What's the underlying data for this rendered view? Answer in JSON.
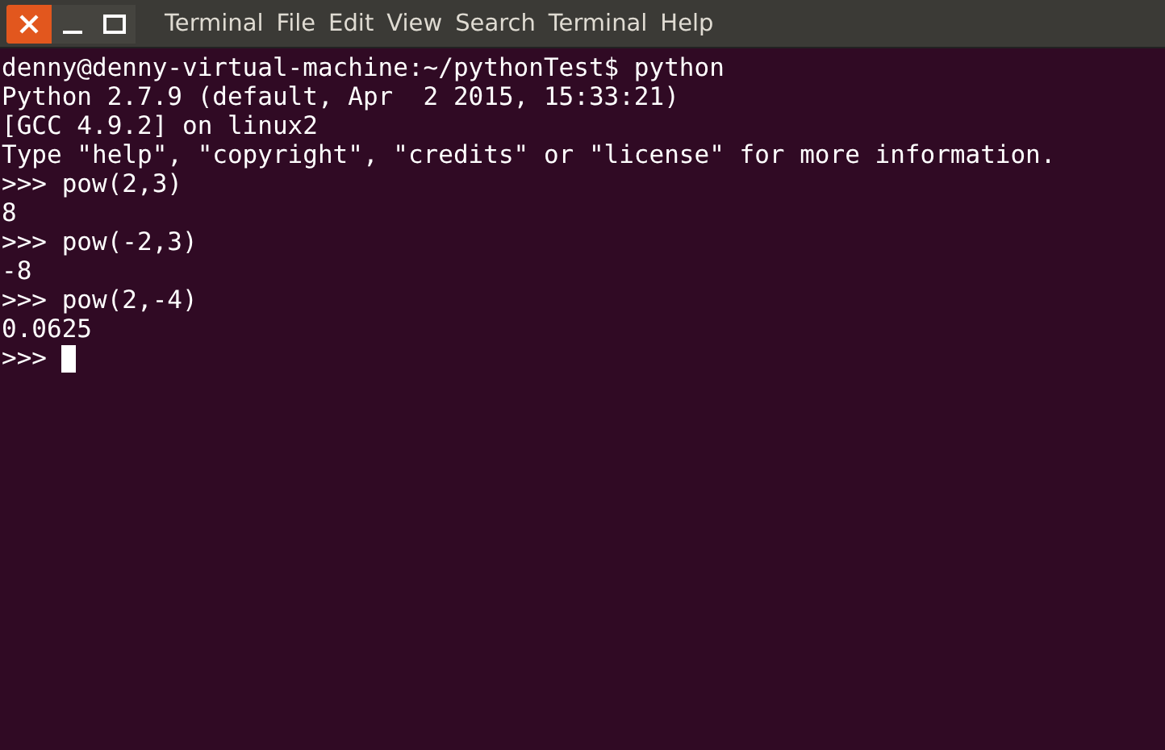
{
  "menu": [
    "Terminal",
    "File",
    "Edit",
    "View",
    "Search",
    "Terminal",
    "Help"
  ],
  "terminal": {
    "lines": [
      "denny@denny-virtual-machine:~/pythonTest$ python",
      "Python 2.7.9 (default, Apr  2 2015, 15:33:21)",
      "[GCC 4.9.2] on linux2",
      "Type \"help\", \"copyright\", \"credits\" or \"license\" for more information.",
      ">>> pow(2,3)",
      "8",
      ">>> pow(-2,3)",
      "-8",
      ">>> pow(2,-4)",
      "0.0625"
    ],
    "prompt": ">>>"
  }
}
